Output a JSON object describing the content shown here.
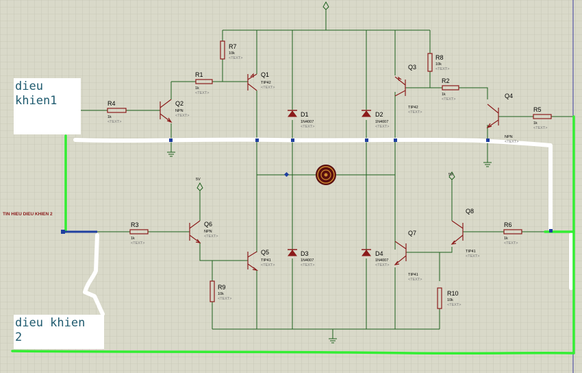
{
  "notes": {
    "note1": "dieu\nkhien1",
    "note2": "dieu khien\n2"
  },
  "signal_label": "TIN HIEU DIEU KHIEN 2",
  "power_labels": {
    "q6": "5V",
    "q8": "5V"
  },
  "components": {
    "R1": {
      "ref": "R1",
      "value": "1k",
      "text": "<TEXT>"
    },
    "R2": {
      "ref": "R2",
      "value": "1k",
      "text": "<TEXT>"
    },
    "R3": {
      "ref": "R3",
      "value": "1k",
      "text": "<TEXT>"
    },
    "R4": {
      "ref": "R4",
      "value": "1k",
      "text": "<TEXT>"
    },
    "R5": {
      "ref": "R5",
      "value": "1k",
      "text": "<TEXT>"
    },
    "R6": {
      "ref": "R6",
      "value": "1k",
      "text": "<TEXT>"
    },
    "R7": {
      "ref": "R7",
      "value": "10k",
      "text": "<TEXT>"
    },
    "R8": {
      "ref": "R8",
      "value": "10k",
      "text": "<TEXT>"
    },
    "R9": {
      "ref": "R9",
      "value": "10k",
      "text": "<TEXT>"
    },
    "R10": {
      "ref": "R10",
      "value": "10k",
      "text": "<TEXT>"
    },
    "Q1": {
      "ref": "Q1",
      "value": "TIP42",
      "text": "<TEXT>"
    },
    "Q2": {
      "ref": "Q2",
      "value": "NPN",
      "text": "<TEXT>"
    },
    "Q3": {
      "ref": "Q3",
      "value": "TIP42",
      "text": "<TEXT>"
    },
    "Q4": {
      "ref": "Q4",
      "value": "NPN",
      "text": "<TEXT>"
    },
    "Q5": {
      "ref": "Q5",
      "value": "TIP41",
      "text": "<TEXT>"
    },
    "Q6": {
      "ref": "Q6",
      "value": "NPN",
      "text": "<TEXT>"
    },
    "Q7": {
      "ref": "Q7",
      "value": "TIP41",
      "text": "<TEXT>"
    },
    "Q8": {
      "ref": "Q8",
      "value": "TIP41",
      "text": "<TEXT>"
    },
    "D1": {
      "ref": "D1",
      "value": "1N4007",
      "text": "<TEXT>"
    },
    "D2": {
      "ref": "D2",
      "value": "1N4007",
      "text": "<TEXT>"
    },
    "D3": {
      "ref": "D3",
      "value": "1N4007",
      "text": "<TEXT>"
    },
    "D4": {
      "ref": "D4",
      "value": "1N4007",
      "text": "<TEXT>"
    }
  },
  "colors": {
    "background": "#d9d9c9",
    "grid": "#bdbdaa",
    "wire": "#1b5e1b",
    "component": "#8b1a1a",
    "highlight": "#33ee33",
    "signal_wire": "#1f3fa0",
    "note_text": "#1e5a6e",
    "signal_label": "#8b1a1a"
  }
}
